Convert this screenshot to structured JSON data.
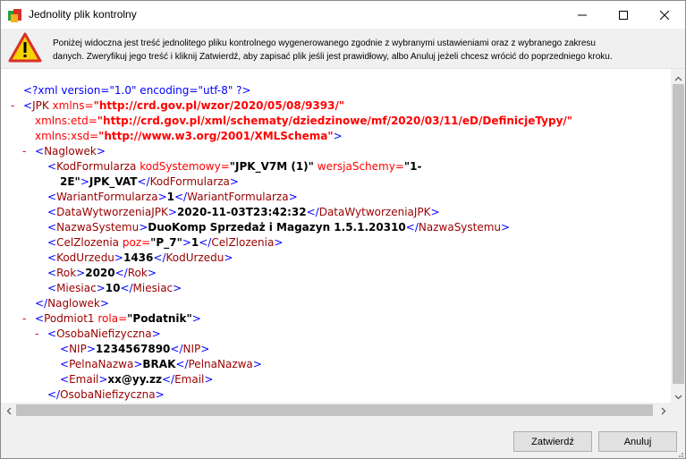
{
  "window": {
    "title": "Jednolity plik kontrolny",
    "info_line1": "Poniżej widoczna jest treść jednolitego pliku kontrolnego wygenerowanego zgodnie z wybranymi ustawieniami oraz z wybranego zakresu",
    "info_line2": "danych. Zweryfikuj jego treść i kliknij Zatwierdź, aby zapisać plik jeśli jest prawidłowy, albo Anuluj jeżeli chcesz wrócić do poprzedniego kroku."
  },
  "xml": {
    "collapse_glyph": "-",
    "decl": "<?xml version=\"1.0\" encoding=\"utf-8\" ?>",
    "jpk": {
      "open": "<",
      "name": "JPK",
      "attr_xmlns": "xmlns=",
      "val_xmlns": "\"http://crd.gov.pl/wzor/2020/05/08/9393/\"",
      "attr_etd": "xmlns:etd=",
      "val_etd": "\"http://crd.gov.pl/xml/schematy/dziedzinowe/mf/2020/03/11/eD/DefinicjeTypy/\"",
      "attr_xsd": "xmlns:xsd=",
      "val_xsd": "\"http://www.w3.org/2001/XMLSchema\"",
      "close": ">"
    },
    "naglowek": {
      "open_tag": "Naglowek",
      "kod_tag": "KodFormularza",
      "kod_attr1": "kodSystemowy=",
      "kod_attr1_val": "\"JPK_V7M (1)\"",
      "kod_attr2": "wersjaSchemy=",
      "kod_attr2_val_a": "\"1-",
      "kod_attr2_val_b": "2E\"",
      "kod_value": "JPK_VAT",
      "wariant_tag": "WariantFormularza",
      "wariant_value": "1",
      "data_tag": "DataWytworzeniaJPK",
      "data_value": "2020-11-03T23:42:32",
      "system_tag": "NazwaSystemu",
      "system_value": "DuoKomp Sprzedaż i Magazyn 1.5.1.20310",
      "cel_tag": "CelZlozenia",
      "cel_attr": "poz=",
      "cel_attr_val": "\"P_7\"",
      "cel_value": "1",
      "urzad_tag": "KodUrzedu",
      "urzad_value": "1436",
      "rok_tag": "Rok",
      "rok_value": "2020",
      "miesiac_tag": "Miesiac",
      "miesiac_value": "10"
    },
    "podmiot": {
      "tag": "Podmiot1",
      "attr": "rola=",
      "attr_val": "\"Podatnik\"",
      "osoba_tag": "OsobaNiefizyczna",
      "nip_tag": "NIP",
      "nip_value": "1234567890",
      "nazwa_tag": "PelnaNazwa",
      "nazwa_value": "BRAK",
      "email_tag": "Email",
      "email_value": "xx@yy.zz"
    }
  },
  "footer": {
    "ok_label": "Zatwierdź",
    "cancel_label": "Anuluj"
  }
}
